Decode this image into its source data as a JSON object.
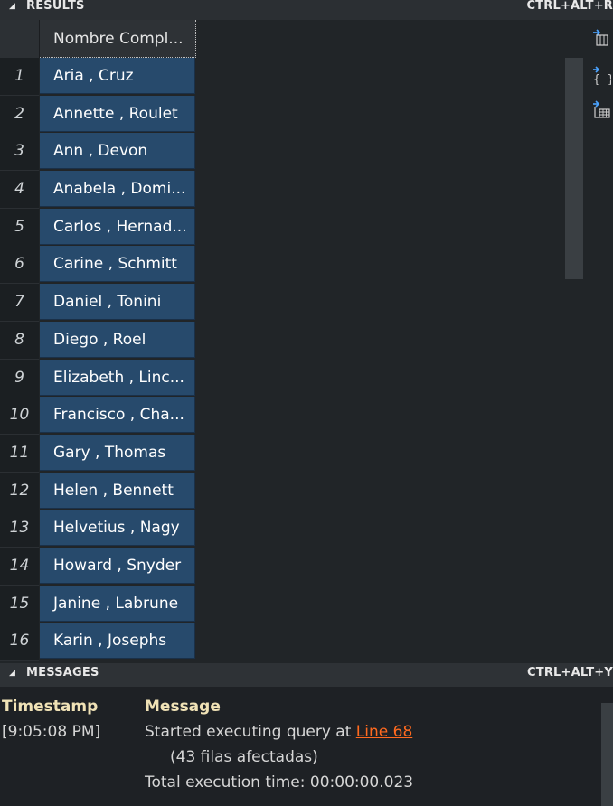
{
  "results_panel": {
    "title": "RESULTS",
    "shortcut": "CTRL+ALT+R",
    "column_header": "Nombre Compl...",
    "rows": [
      {
        "num": "1",
        "value": "Aria , Cruz"
      },
      {
        "num": "2",
        "value": "Annette , Roulet"
      },
      {
        "num": "3",
        "value": "Ann , Devon"
      },
      {
        "num": "4",
        "value": "Anabela , Domi..."
      },
      {
        "num": "5",
        "value": "Carlos , Hernad..."
      },
      {
        "num": "6",
        "value": "Carine , Schmitt"
      },
      {
        "num": "7",
        "value": "Daniel , Tonini"
      },
      {
        "num": "8",
        "value": "Diego , Roel"
      },
      {
        "num": "9",
        "value": "Elizabeth , Linc..."
      },
      {
        "num": "10",
        "value": "Francisco , Cha..."
      },
      {
        "num": "11",
        "value": "Gary , Thomas"
      },
      {
        "num": "12",
        "value": "Helen , Bennett"
      },
      {
        "num": "13",
        "value": "Helvetius , Nagy"
      },
      {
        "num": "14",
        "value": "Howard , Snyder"
      },
      {
        "num": "15",
        "value": "Janine , Labrune"
      },
      {
        "num": "16",
        "value": "Karin , Josephs"
      }
    ],
    "side_icons": [
      "export-csv-icon",
      "export-json-icon",
      "export-excel-icon"
    ]
  },
  "messages_panel": {
    "title": "MESSAGES",
    "shortcut": "CTRL+ALT+Y",
    "timestamp_header": "Timestamp",
    "message_header": "Message",
    "timestamp": "[9:05:08 PM]",
    "started_text": "Started executing query at",
    "line_link": "Line 68",
    "rows_affected": "(43 filas afectadas)",
    "total_time": "Total execution time: 00:00:00.023"
  },
  "colors": {
    "selection": "#274a6c",
    "link": "#ff6a1f",
    "header_text": "#f0e2b6"
  }
}
